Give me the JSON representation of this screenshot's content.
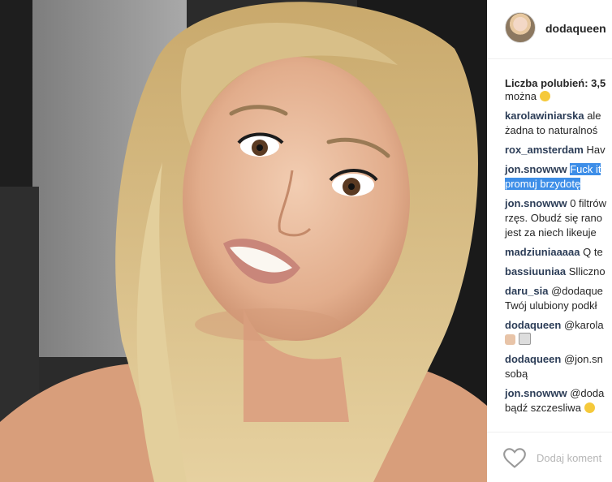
{
  "post": {
    "username": "dodaqueen",
    "likes_label": "Liczba polubień: 3,5",
    "partial_text": "można",
    "add_comment_placeholder": "Dodaj koment"
  },
  "comments": [
    {
      "user": "karolawiniarska",
      "lines": [
        "ale",
        "żadna to naturalnoś"
      ]
    },
    {
      "user": "rox_amsterdam",
      "lines": [
        "Hav"
      ]
    },
    {
      "user": "jon.snowww",
      "lines": [
        "Fuck it",
        "promuj brzydotę"
      ],
      "highlight": true
    },
    {
      "user": "jon.snowww",
      "lines": [
        "0 filtrów",
        "rzęs. Obudź się rano",
        "jest za niech likeuje"
      ]
    },
    {
      "user": "madziuniaaaaa",
      "lines": [
        "Q te"
      ]
    },
    {
      "user": "bassiuuniaa",
      "lines": [
        "Slliczno"
      ]
    },
    {
      "user": "daru_sia",
      "lines": [
        "@dodaque",
        "Twój ulubiony podkł"
      ]
    },
    {
      "user": "dodaqueen",
      "lines": [
        "@karola",
        ""
      ]
    },
    {
      "user": "dodaqueen",
      "lines": [
        "@jon.sn",
        "sobą"
      ]
    },
    {
      "user": "jon.snowww",
      "lines": [
        "@doda",
        "bądź szczesliwa"
      ]
    }
  ],
  "icons": {
    "like": "heart-icon",
    "avatar": "avatar"
  },
  "colors": {
    "username_link": "#2c3d57",
    "highlight": "#3d8ee8",
    "placeholder": "#b6b6b6"
  }
}
